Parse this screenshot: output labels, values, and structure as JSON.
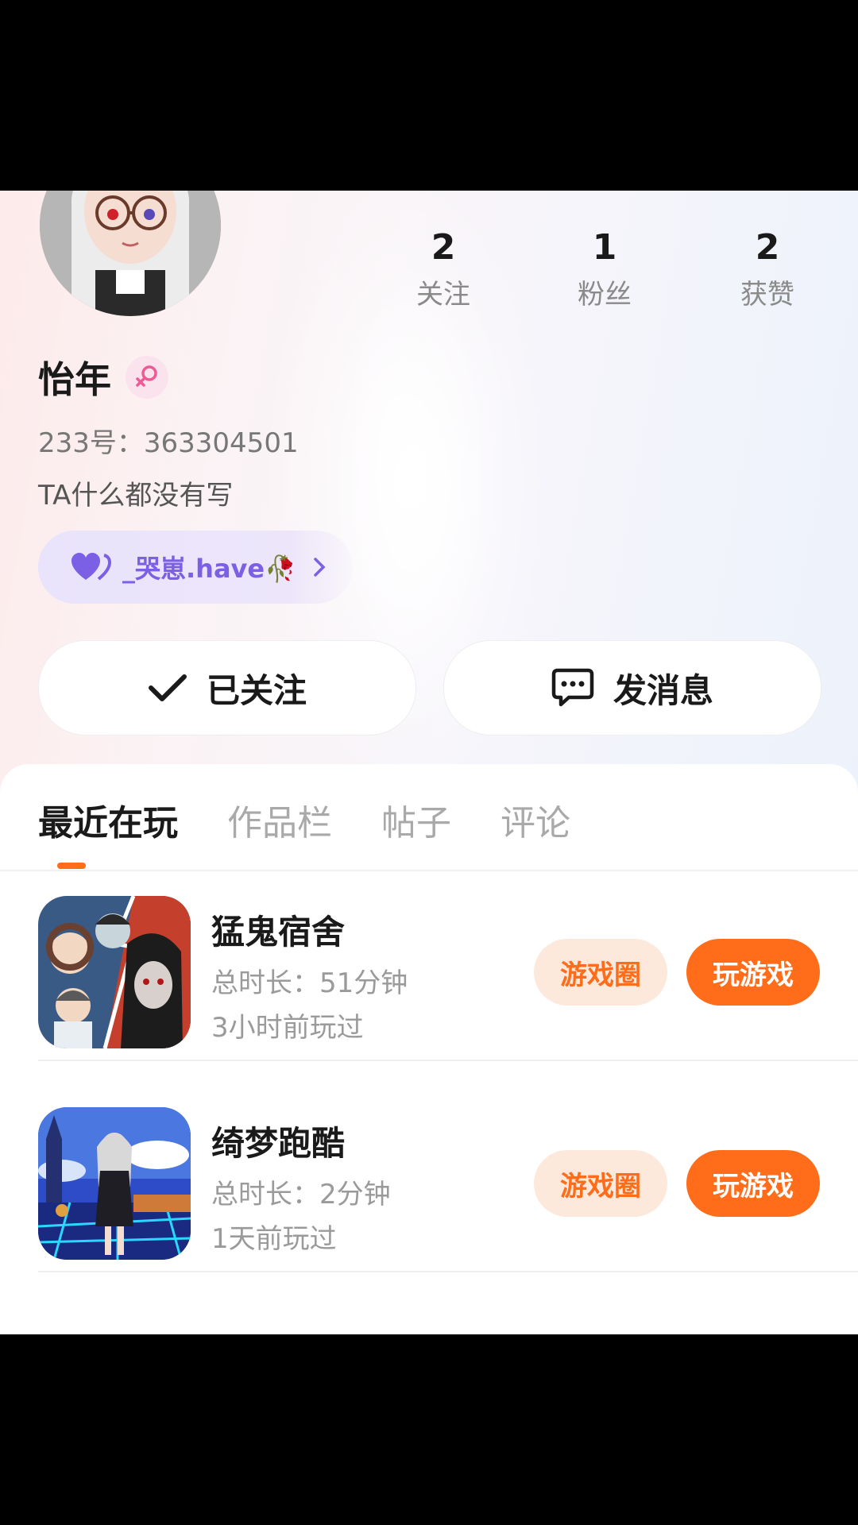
{
  "profile": {
    "name": "怡年",
    "uid_text": "233号：363304501",
    "bio": "TA什么都没有写",
    "tag_text": "_哭崽.have🥀",
    "stats": [
      {
        "value": "2",
        "label": "关注"
      },
      {
        "value": "1",
        "label": "粉丝"
      },
      {
        "value": "2",
        "label": "获赞"
      }
    ]
  },
  "actions": {
    "follow_label": "已关注",
    "message_label": "发消息"
  },
  "tabs": [
    "最近在玩",
    "作品栏",
    "帖子",
    "评论"
  ],
  "games": [
    {
      "title": "猛鬼宿舍",
      "duration": "总时长：51分钟",
      "last_played": "3小时前玩过",
      "circle_label": "游戏圈",
      "play_label": "玩游戏"
    },
    {
      "title": "绮梦跑酷",
      "duration": "总时长：2分钟",
      "last_played": "1天前玩过",
      "circle_label": "游戏圈",
      "play_label": "玩游戏"
    }
  ],
  "colors": {
    "accent": "#ff6d1a",
    "accent_light": "#fde8dc",
    "tag_purple": "#7b60e6",
    "gender_pink": "#ee5a95"
  },
  "icons": [
    "avatar",
    "female-icon",
    "heart-icon",
    "chevron-right-icon",
    "check-icon",
    "chat-bubble-icon"
  ]
}
